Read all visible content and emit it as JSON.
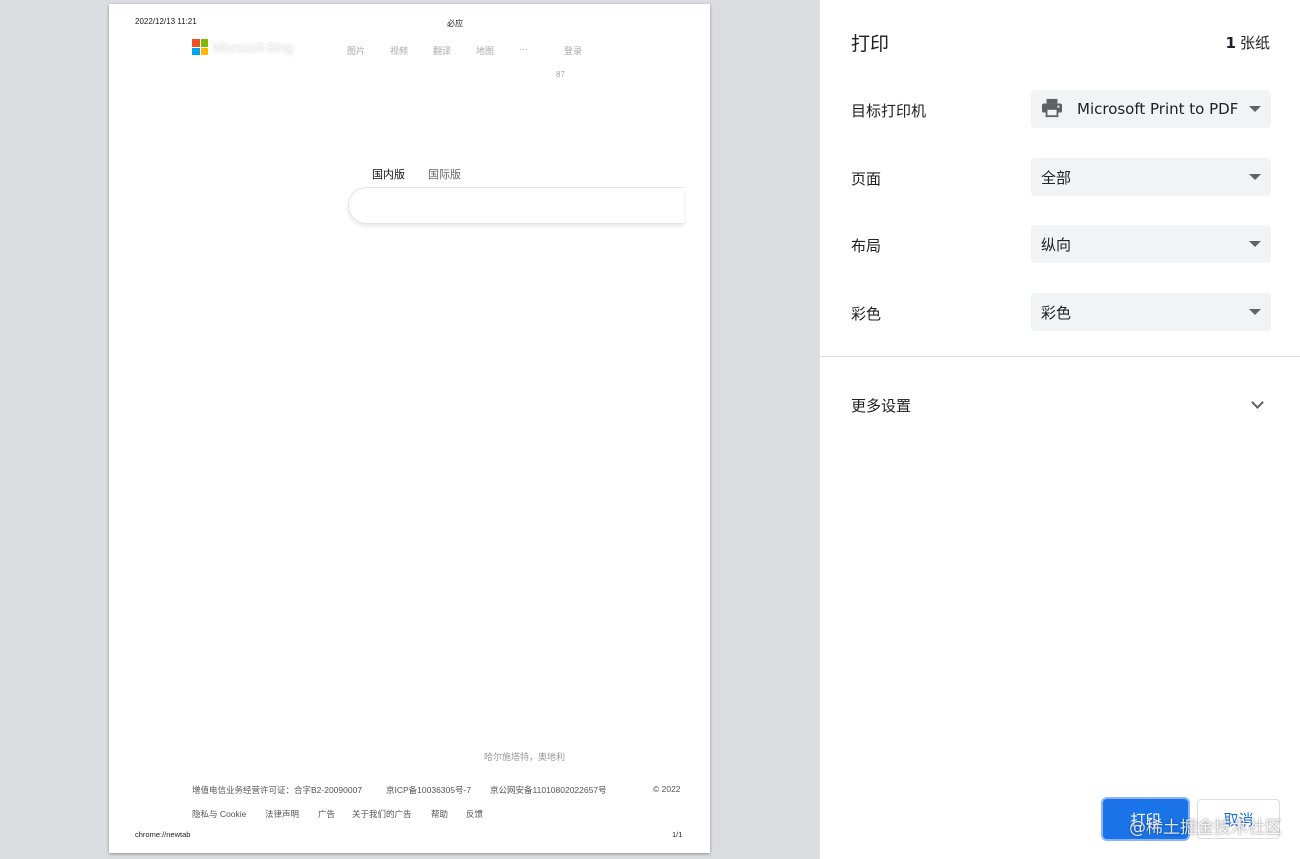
{
  "preview": {
    "header_date": "2022/12/13 11:21",
    "header_title": "必应",
    "logo_text": "Microsoft Bing",
    "nav": [
      "图片",
      "视频",
      "翻译",
      "地图",
      "···",
      "登录"
    ],
    "nav_count": "87",
    "tabs": [
      "国内版",
      "国际版"
    ],
    "caption": "哈尔施塔特，奥地利",
    "footer_links_row1": [
      "增值电信业务经营许可证：合字B2-20090007",
      "京ICP备10036305号-7",
      "京公网安备11010802022657号"
    ],
    "copyright": "© 2022",
    "footer_links_row2": [
      "隐私与 Cookie",
      "法律声明",
      "广告",
      "关于我们的广告",
      "帮助",
      "反馈"
    ],
    "footer_url": "chrome://newtab",
    "footer_page": "1/1",
    "logo_colors": [
      "#f25022",
      "#7fba00",
      "#00a4ef",
      "#ffb900"
    ]
  },
  "panel": {
    "title": "打印",
    "sheet_number": "1",
    "sheet_unit": "张纸",
    "destination": {
      "label": "目标打印机",
      "value": "Microsoft Print to PDF",
      "icon": "printer-icon"
    },
    "pages": {
      "label": "页面",
      "value": "全部"
    },
    "layout": {
      "label": "布局",
      "value": "纵向"
    },
    "color": {
      "label": "彩色",
      "value": "彩色"
    },
    "more_settings": "更多设置",
    "print_button": "打印",
    "cancel_button": "取消",
    "watermark": "@稀土掘金技术社区",
    "accent_color": "#1a73e8"
  }
}
